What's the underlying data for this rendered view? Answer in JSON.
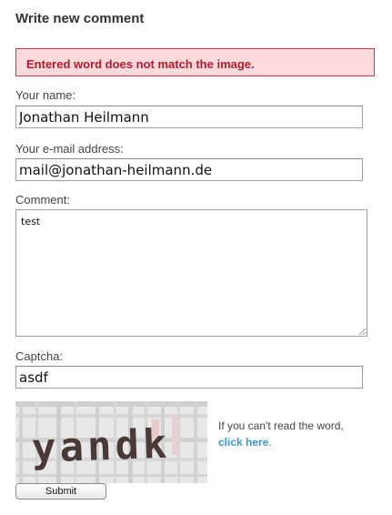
{
  "form": {
    "title": "Write new comment",
    "error_message": "Entered word does not match the image.",
    "name": {
      "label": "Your name:",
      "value": "Jonathan Heilmann"
    },
    "email": {
      "label": "Your e-mail address:",
      "value": "mail@jonathan-heilmann.de"
    },
    "comment": {
      "label": "Comment:",
      "value": "test"
    },
    "captcha": {
      "label": "Captcha:",
      "value": "asdf",
      "image_word": "yandk",
      "help_text": "If you can't read the word, ",
      "help_link": "click here",
      "help_suffix": "."
    },
    "submit_label": "Submit"
  },
  "colors": {
    "error_background": "#fcd9db",
    "error_border": "#c73a48",
    "error_text": "#b7192a",
    "link": "#3a96d8"
  }
}
